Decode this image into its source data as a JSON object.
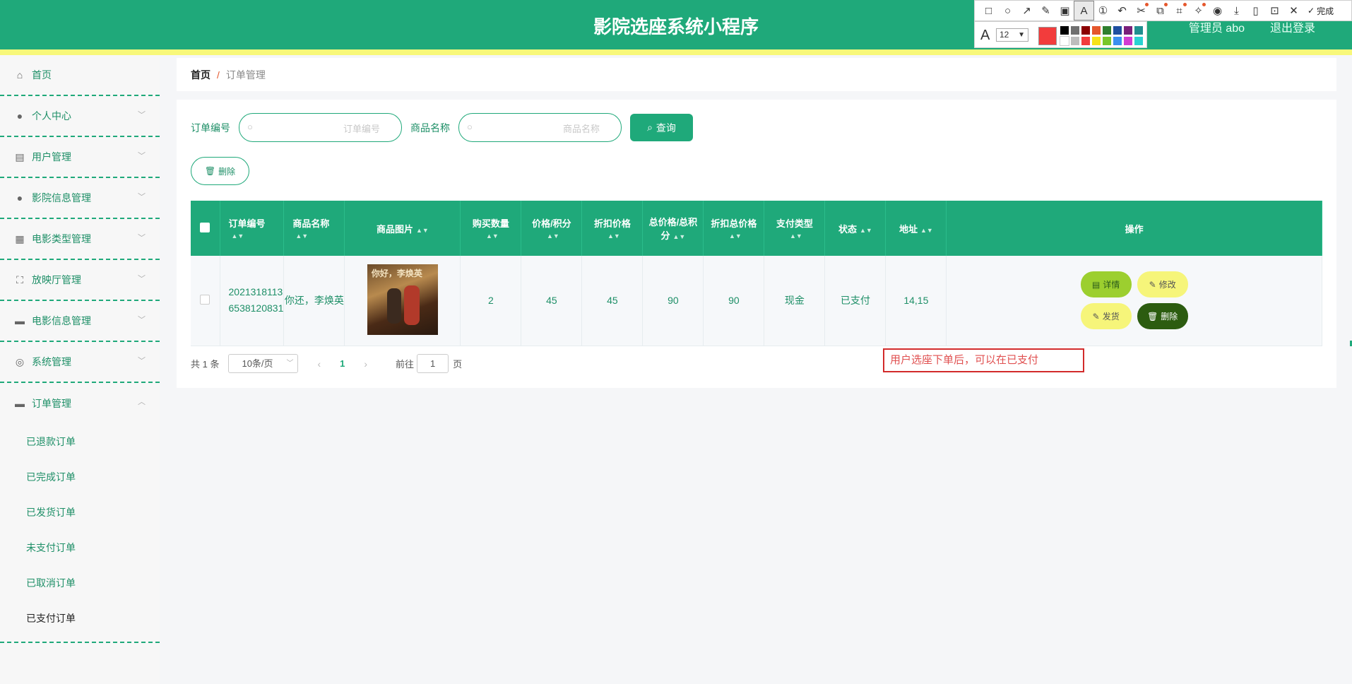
{
  "header": {
    "title": "影院选座系统小程序",
    "user": "管理员 abo",
    "logout": "退出登录"
  },
  "colors": {
    "primary": "#1fa97a",
    "accent_strip": "#f8f87a",
    "annotation_red": "#d22b2b"
  },
  "screenshot_tool": {
    "font_size": "12",
    "done_label": "完成",
    "current_color": "#f23c3c",
    "palette": [
      "#000000",
      "#6f6f6f",
      "#8b0000",
      "#e5572c",
      "#2f7f2f",
      "#1f4fa0",
      "#7a1f7a",
      "#1f8f8f",
      "#ffffff",
      "#bdbdbd",
      "#f23c3c",
      "#f6e21a",
      "#79c62a",
      "#3b8ff0",
      "#d23cd2",
      "#2ad2d2"
    ]
  },
  "sidebar": {
    "items": [
      {
        "label": "首页",
        "icon": "home-icon"
      },
      {
        "label": "个人中心",
        "icon": "person-icon"
      },
      {
        "label": "用户管理",
        "icon": "chart-icon"
      },
      {
        "label": "影院信息管理",
        "icon": "person-icon"
      },
      {
        "label": "电影类型管理",
        "icon": "grid-icon"
      },
      {
        "label": "放映厅管理",
        "icon": "frame-icon"
      },
      {
        "label": "电影信息管理",
        "icon": "briefcase-icon"
      },
      {
        "label": "系统管理",
        "icon": "lifebuoy-icon"
      },
      {
        "label": "订单管理",
        "icon": "suitcase-icon"
      }
    ],
    "sub_items": [
      "已退款订单",
      "已完成订单",
      "已发货订单",
      "未支付订单",
      "已取消订单",
      "已支付订单"
    ]
  },
  "breadcrumb": {
    "home": "首页",
    "separator": "/",
    "current": "订单管理"
  },
  "search": {
    "order_no_label": "订单编号",
    "order_no_placeholder": "订单编号",
    "goods_label": "商品名称",
    "goods_placeholder": "商品名称",
    "query_button": "查询"
  },
  "actions": {
    "delete_button": "删除"
  },
  "table": {
    "headers": [
      "订单编号",
      "商品名称",
      "商品图片",
      "购买数量",
      "价格/积分",
      "折扣价格",
      "总价格/总积分",
      "折扣总价格",
      "支付类型",
      "状态",
      "地址",
      "操作"
    ],
    "rows": [
      {
        "order_no_line1": "2021318113",
        "order_no_line2": "6538120831",
        "goods_name": "你还，李焕英",
        "poster_title": "你好，李焕英",
        "quantity": "2",
        "price": "45",
        "discount_price": "45",
        "total": "90",
        "discount_total": "90",
        "pay_type": "现金",
        "status": "已支付",
        "address": "14,15",
        "ops": {
          "detail": "详情",
          "edit": "修改",
          "ship": "发货",
          "delete": "删除"
        }
      }
    ]
  },
  "pagination": {
    "total": "共 1 条",
    "page_size": "10条/页",
    "current_page": "1",
    "goto_label": "前往",
    "goto_value": "1",
    "page_unit": "页"
  },
  "annotation": {
    "text": "用户选座下单后，可以在已支付"
  }
}
